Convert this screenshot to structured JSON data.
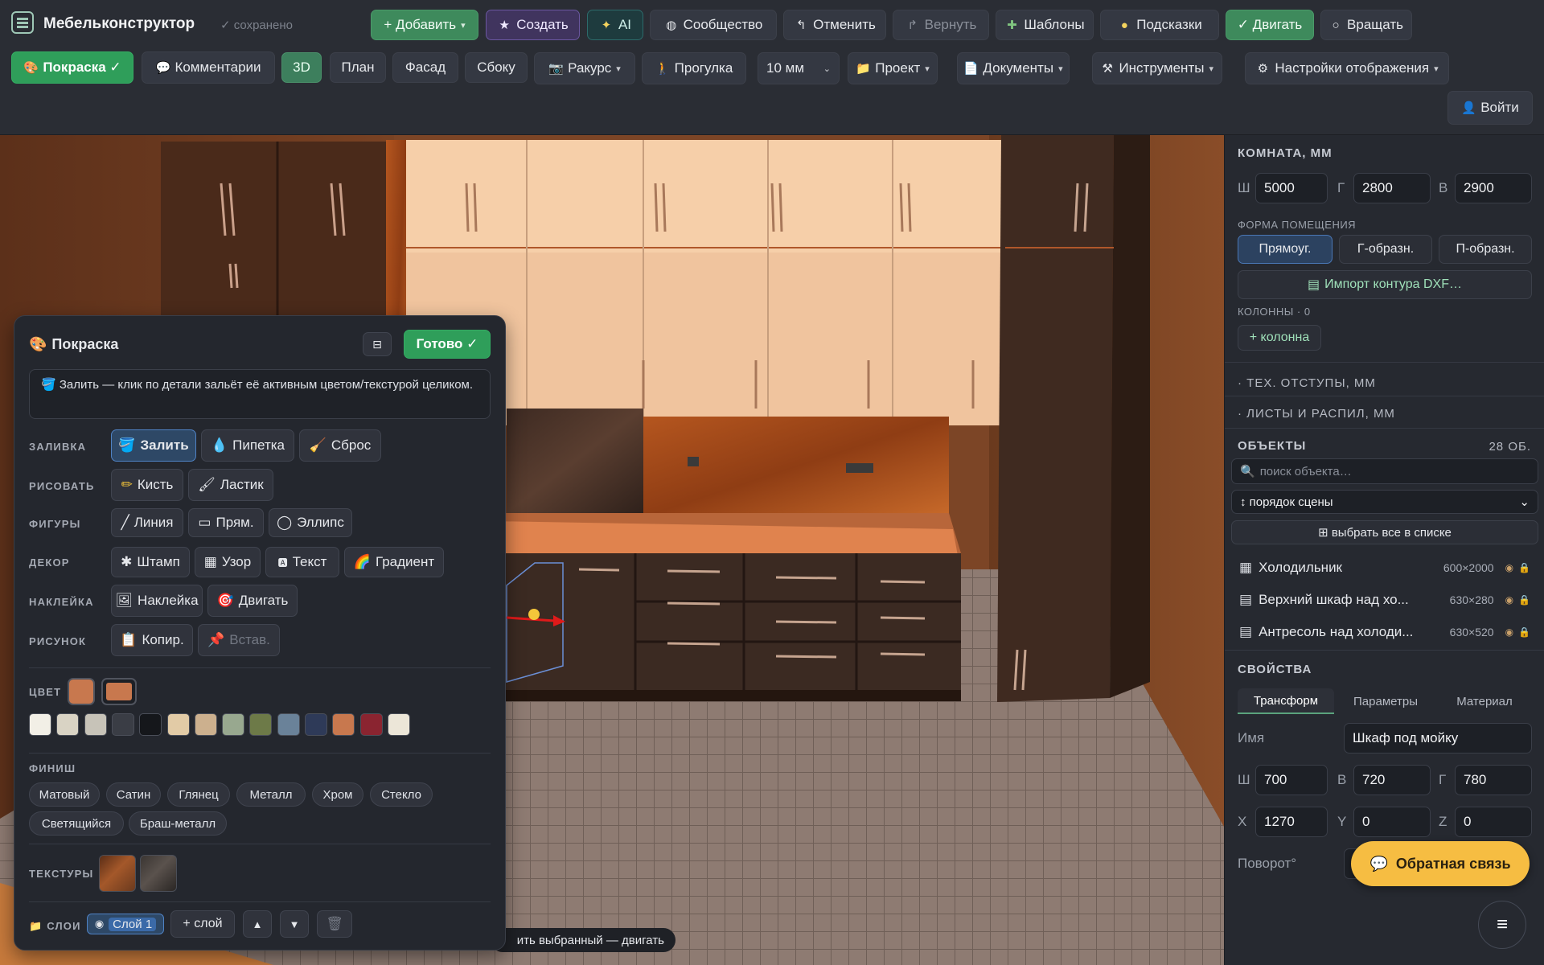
{
  "app": {
    "title": "Мебельконструктор",
    "saved": "✓ сохранено"
  },
  "toolbar1": {
    "add": "+ Добавить",
    "create": "Создать",
    "ai": "AI",
    "community": "Сообщество",
    "undo": "Отменить",
    "redo": "Вернуть",
    "templates": "Шаблоны",
    "hints": "Подсказки",
    "move": "✓ Двигать",
    "rotate": "Вращать"
  },
  "toolbar2": {
    "paint": "Покраска ✓",
    "comments": "Комментарии",
    "view_3d": "3D",
    "view_plan": "План",
    "view_facade": "Фасад",
    "view_side": "Сбоку",
    "angle": "Ракурс",
    "walk": "Прогулка",
    "step": "10 мм",
    "project": "Проект",
    "documents": "Документы",
    "tools": "Инструменты",
    "display": "Настройки отображения",
    "login": "Войти"
  },
  "room": {
    "title": "КОМНАТА, ММ",
    "w_label": "Ш",
    "w": "5000",
    "d_label": "Г",
    "d": "2800",
    "h_label": "В",
    "h": "2900",
    "shape_label": "ФОРМА ПОМЕЩЕНИЯ",
    "shapes": [
      "Прямоуг.",
      "Г-образн.",
      "П-образн."
    ],
    "import": "Импорт контура DXF…",
    "columns_label": "КОЛОННЫ · 0",
    "add_column": "+ колонна",
    "tech": "ТЕХ. ОТСТУПЫ, ММ",
    "sheets": "ЛИСТЫ И РАСПИЛ, ММ"
  },
  "objects": {
    "title": "ОБЪЕКТЫ",
    "count": "28 ОБ.",
    "search_placeholder": "поиск объекта…",
    "order": "↕ порядок сцены",
    "select_all": "⊞ выбрать все в списке",
    "items": [
      {
        "name": "Холодильник",
        "size": "600×2000"
      },
      {
        "name": "Верхний шкаф над хо...",
        "size": "630×280"
      },
      {
        "name": "Антресоль над холоди...",
        "size": "630×520"
      }
    ]
  },
  "props": {
    "title": "СВОЙСТВА",
    "tabs": [
      "Трансформ",
      "Параметры",
      "Материал"
    ],
    "name_label": "Имя",
    "name": "Шкаф под мойку",
    "w_label": "Ш",
    "w": "700",
    "h_label": "В",
    "h": "720",
    "d_label": "Г",
    "d": "780",
    "x_label": "X",
    "x": "1270",
    "y_label": "Y",
    "y": "0",
    "z_label": "Z",
    "z": "0",
    "rot_label": "Поворот°"
  },
  "feedback": "Обратная связь",
  "paint": {
    "title": "Покраска",
    "done": "Готово ✓",
    "hint": "Залить — клик по детали зальёт её активным цветом/текстурой целиком.",
    "fill_label": "ЗАЛИВКА",
    "fill": "Залить",
    "pipette": "Пипетка",
    "reset": "Сброс",
    "draw_label": "РИСОВАТЬ",
    "brush": "Кисть",
    "eraser": "Ластик",
    "shapes_label": "ФИГУРЫ",
    "line": "Линия",
    "rect": "Прям.",
    "ellipse": "Эллипс",
    "decor_label": "ДЕКОР",
    "stamp": "Штамп",
    "pattern": "Узор",
    "text": "Текст",
    "gradient": "Градиент",
    "sticker_label": "НАКЛЕЙКА",
    "sticker": "Наклейка",
    "sticker_move": "Двигать",
    "picture_label": "РИСУНОК",
    "copy": "Копир.",
    "paste": "Встав.",
    "color_label": "ЦВЕТ",
    "active_color": "#c8784e",
    "palette": [
      "#f2efe6",
      "#d9d3c4",
      "#c7c3b8",
      "#3a3d45",
      "#15171b",
      "#e2cba6",
      "#ccb08e",
      "#98a88f",
      "#6d7a48",
      "#6a8299",
      "#2e3a58",
      "#c8784e",
      "#8a2430",
      "#ece6d8"
    ],
    "finish_label": "ФИНИШ",
    "finishes": [
      "Матовый",
      "Сатин",
      "Глянец",
      "Металл",
      "Хром",
      "Стекло",
      "Светящийся",
      "Браш-металл"
    ],
    "textures_label": "ТЕКСТУРЫ",
    "layers_label": "СЛОИ",
    "layer": "Слой 1",
    "add_layer": "+ слой"
  },
  "toast": "ить выбранный — двигать"
}
